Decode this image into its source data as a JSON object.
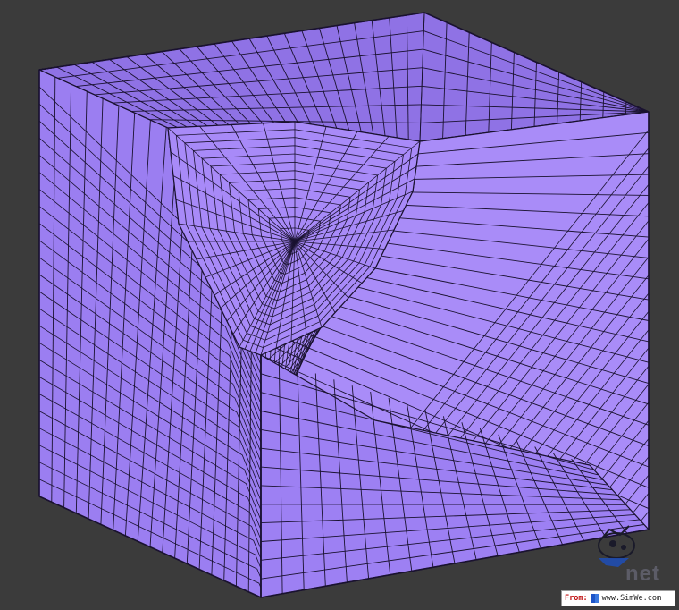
{
  "figure": {
    "background": "#3b3b3b",
    "subject": "meshed cube with spherical cavity",
    "mesh_color": "#9d80f3",
    "mesh_shade_top": "#8f72e5",
    "mesh_shade_right": "#a98cf8",
    "mesh_shade_left": "#9b7ef1",
    "edge_color": "#1a1230"
  },
  "watermark": {
    "from_label": "From:",
    "site": "www.SimWe.com",
    "logo_text": "net"
  }
}
